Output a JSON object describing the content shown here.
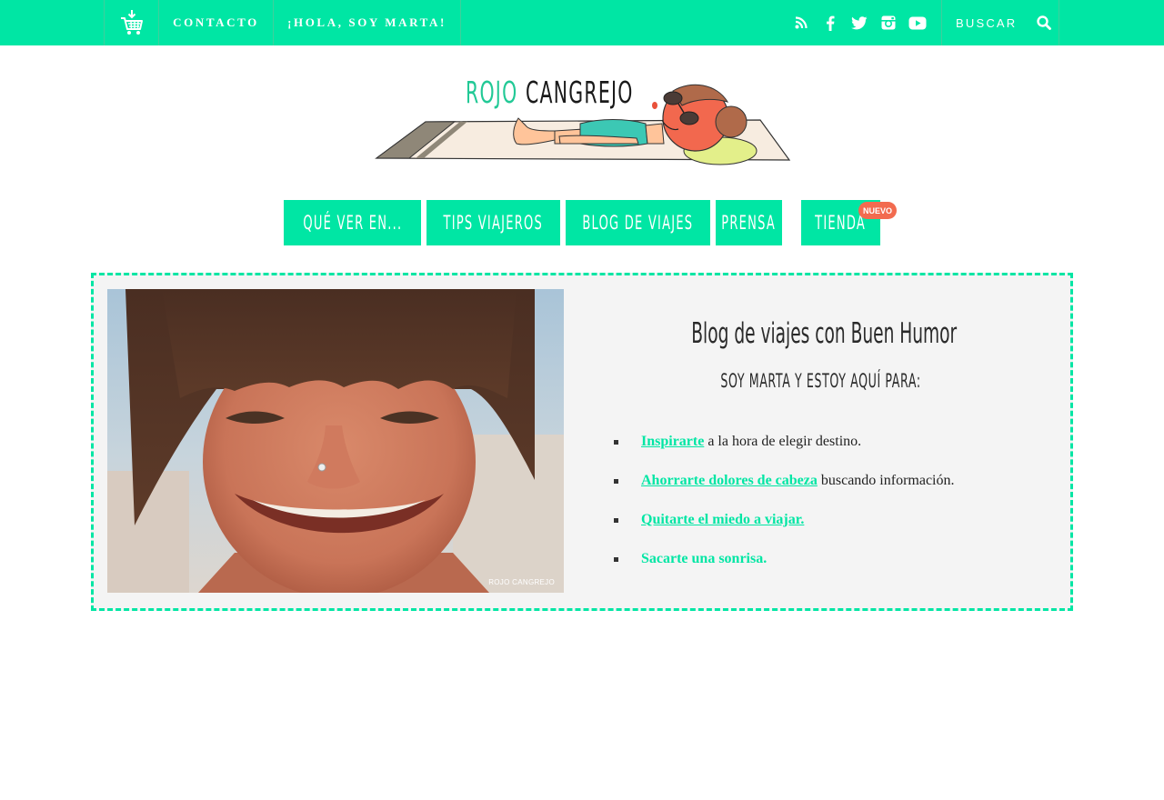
{
  "topbar": {
    "cart_icon": "shopping-cart-icon",
    "links": [
      {
        "label": "CONTACTO"
      },
      {
        "label": "¡HOLA, SOY MARTA!"
      }
    ],
    "social_icons": [
      "rss-icon",
      "facebook-icon",
      "twitter-icon",
      "instagram-icon",
      "youtube-icon"
    ],
    "search": {
      "placeholder": "BUSCAR",
      "value": "",
      "icon": "search-icon"
    },
    "colors": {
      "accent": "#00e6a4",
      "text": "#ffffff"
    }
  },
  "logo": {
    "word1": "ROJO",
    "word2": "CANGREJO",
    "colors": {
      "word1": "#22c996",
      "word2": "#1a1a1a"
    }
  },
  "main_nav": {
    "items": [
      {
        "label": "Qué ver en..."
      },
      {
        "label": "Tips viajeros"
      },
      {
        "label": "Blog de viajes"
      },
      {
        "label": "Prensa"
      },
      {
        "label": "Tienda"
      }
    ],
    "badge": "NUEVO",
    "colors": {
      "background": "#00e6a4",
      "badge": "#f26b4f"
    }
  },
  "intro": {
    "photo_credit": "ROJO CANGREJO",
    "title": "Blog de viajes con Buen Humor",
    "subtitle": "soy marta y estoy aquí para:",
    "items": [
      {
        "link": "Inspirarte",
        "rest": " a la hora de elegir destino."
      },
      {
        "link": "Ahorrarte dolores de cabeza",
        "rest": " buscando información."
      },
      {
        "link": "Quitarte el miedo a viajar.",
        "rest": ""
      },
      {
        "link": "Sacarte una sonrisa.",
        "rest": ""
      }
    ],
    "colors": {
      "border": "#00e6a4",
      "background": "#f4f4f4",
      "link": "#00e6a4"
    }
  }
}
